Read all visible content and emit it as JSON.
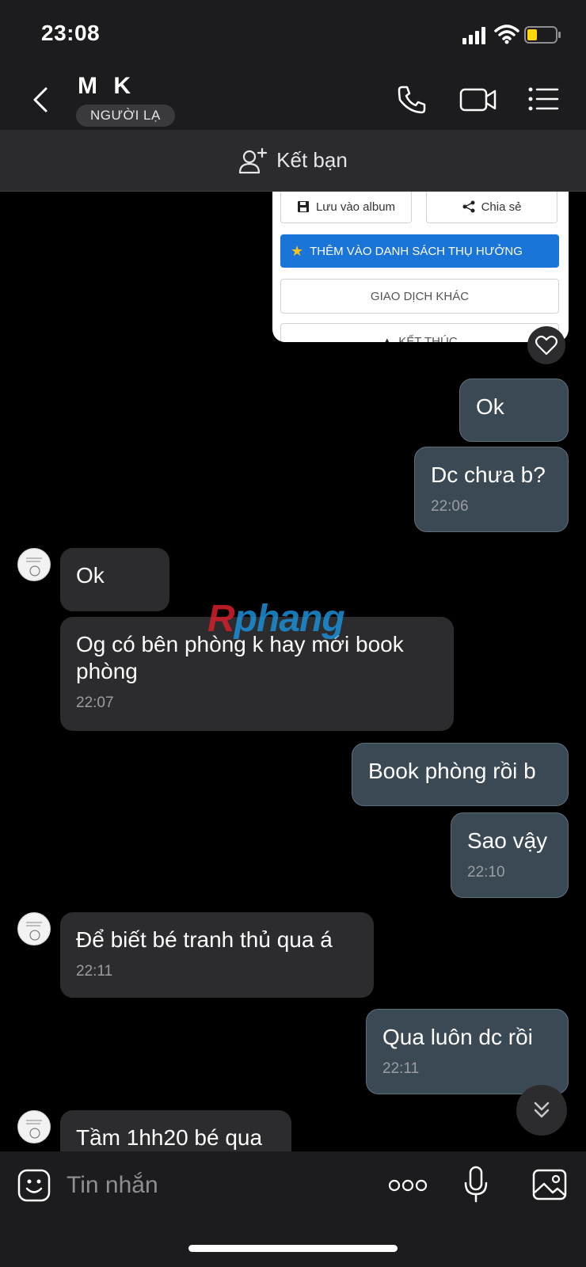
{
  "status_bar": {
    "time": "23:08"
  },
  "header": {
    "contact_name": "M K",
    "badge": "NGƯỜI LẠ"
  },
  "add_friend": {
    "label": "Kết bạn"
  },
  "image_message": {
    "save_label": "Lưu vào album",
    "share_label": "Chia sẻ",
    "beneficiary_label": "THÊM VÀO DANH SÁCH THỤ HƯỞNG",
    "other_label": "GIAO DỊCH KHÁC",
    "end_label": "KẾT THÚC"
  },
  "messages": [
    {
      "side": "out",
      "text": "Ok",
      "time": ""
    },
    {
      "side": "out",
      "text": "Dc chưa b?",
      "time": "22:06"
    },
    {
      "side": "in",
      "text": "Ok",
      "time": ""
    },
    {
      "side": "in",
      "text": "Og có bên phòng k hay mới book phòng",
      "time": "22:07"
    },
    {
      "side": "out",
      "text": "Book phòng rồi b",
      "time": ""
    },
    {
      "side": "out",
      "text": "Sao vậy",
      "time": "22:10"
    },
    {
      "side": "in",
      "text": "Để biết bé tranh thủ qua á",
      "time": "22:11"
    },
    {
      "side": "out",
      "text": "Qua luôn dc rồi",
      "time": "22:11"
    },
    {
      "side": "in",
      "text": "Tầm 1hh20 bé qua",
      "time": ""
    }
  ],
  "watermark": {
    "first": "R",
    "rest": "phang"
  },
  "input": {
    "placeholder": "Tin nhắn"
  },
  "colors": {
    "outgoing_bubble": "#3b4954",
    "incoming_bubble": "#2c2c2e",
    "accent_blue": "#1b74d8",
    "battery": "#ffd60a"
  }
}
